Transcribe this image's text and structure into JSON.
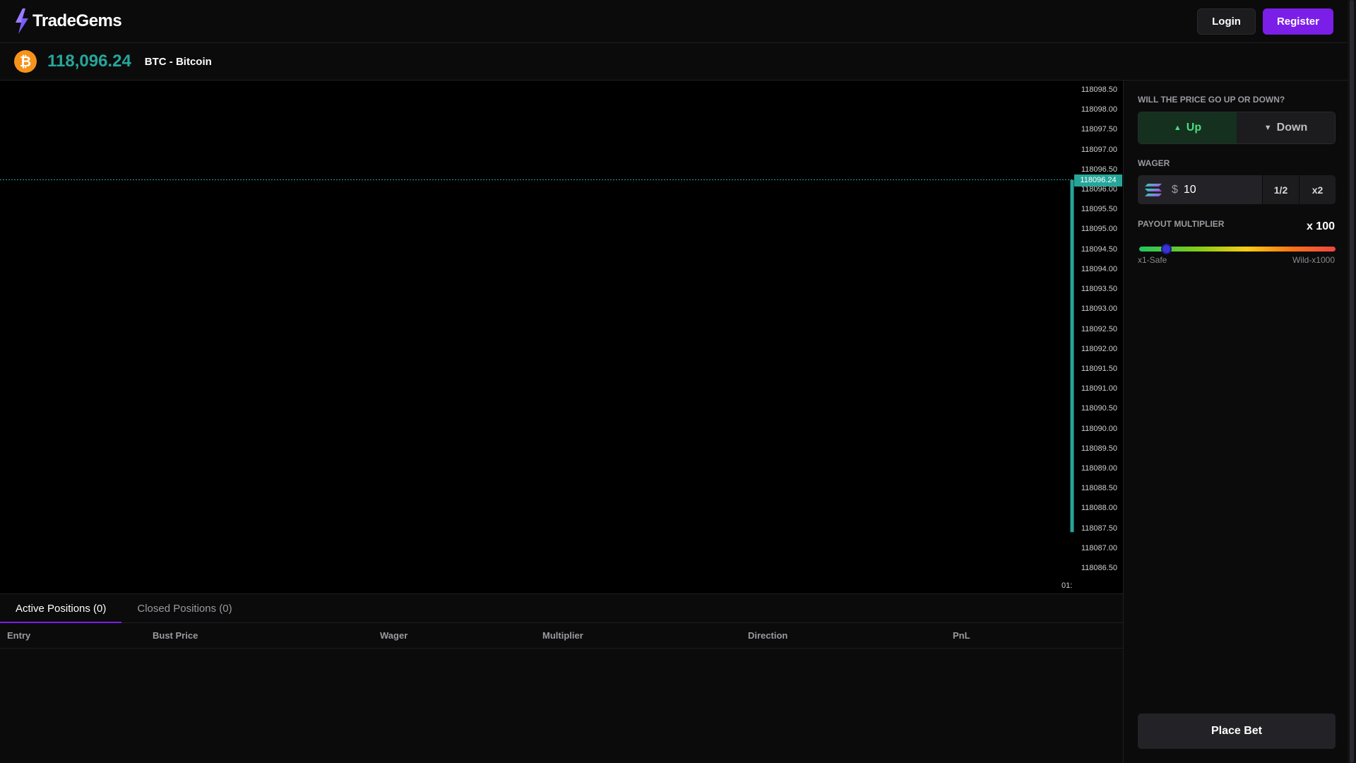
{
  "header": {
    "brand": "TradeGems",
    "login_label": "Login",
    "register_label": "Register"
  },
  "ticker": {
    "coin_symbol": "₿",
    "price": "118,096.24",
    "pair": "BTC - Bitcoin"
  },
  "chart": {
    "current_price": "118096.24",
    "axis_labels": [
      "118098.50",
      "118098.00",
      "118097.50",
      "118097.00",
      "118096.50",
      "118096.00",
      "118095.50",
      "118095.00",
      "118094.50",
      "118094.00",
      "118093.50",
      "118093.00",
      "118092.50",
      "118092.00",
      "118091.50",
      "118091.00",
      "118090.50",
      "118090.00",
      "118089.50",
      "118089.00",
      "118088.50",
      "118088.00",
      "118087.50",
      "118087.00",
      "118086.50"
    ],
    "time_label": "01:"
  },
  "chart_data": {
    "type": "line",
    "y_axis_ticks": [
      118098.5,
      118098.0,
      118097.5,
      118097.0,
      118096.5,
      118096.0,
      118095.5,
      118095.0,
      118094.5,
      118094.0,
      118093.5,
      118093.0,
      118092.5,
      118092.0,
      118091.5,
      118091.0,
      118090.5,
      118090.0,
      118089.5,
      118089.0,
      118088.5,
      118088.0,
      118087.5,
      118087.0,
      118086.5
    ],
    "ylim": [
      118086.5,
      118098.5
    ],
    "current_price": 118096.24,
    "price_line_range": [
      118087.4,
      118096.24
    ],
    "grid": false,
    "line_color": "#26a69a"
  },
  "positions": {
    "tab_active": "Active Positions (0)",
    "tab_closed": "Closed Positions (0)",
    "columns": [
      "Entry",
      "Bust Price",
      "Wager",
      "Multiplier",
      "Direction",
      "PnL"
    ]
  },
  "side": {
    "direction_label": "WILL THE PRICE GO UP OR DOWN?",
    "up_label": "Up",
    "down_label": "Down",
    "wager_label": "WAGER",
    "currency_symbol": "$",
    "wager_value": "10",
    "half_label": "1/2",
    "double_label": "x2",
    "multiplier_label": "PAYOUT MULTIPLIER",
    "multiplier_value": "x 100",
    "slider_min_label": "x1-Safe",
    "slider_max_label": "Wild-x1000",
    "slider_level": 0.1,
    "place_bet_label": "Place Bet"
  },
  "colors": {
    "accent": "#7b1fe8",
    "price_up": "#26a69a",
    "up_green": "#4ade80",
    "bitcoin": "#f7931a"
  },
  "icons": {
    "logo": "lightning-gem-icon",
    "coin": "bitcoin-icon",
    "up": "triangle-up-icon",
    "down": "triangle-down-icon",
    "currency": "solana-icon"
  }
}
